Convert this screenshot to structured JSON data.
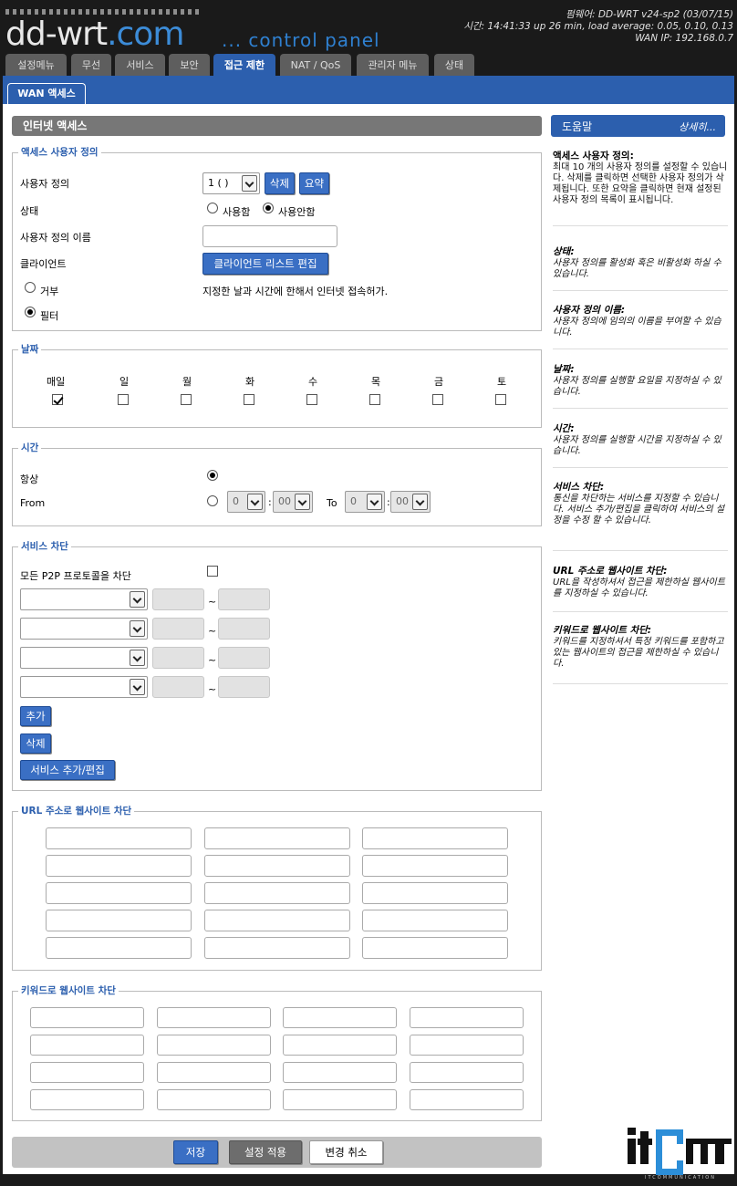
{
  "header": {
    "logo_text_main": "dd-wrt",
    "logo_text_suffix": ".com",
    "control_panel": "... control panel",
    "firmware": "펌웨어: DD-WRT v24-sp2 (03/07/15)",
    "uptime": "시간: 14:41:33 up 26 min, load average: 0.05, 0.10, 0.13",
    "wan_ip": "WAN IP: 192.168.0.7"
  },
  "tabs": [
    "설정메뉴",
    "무선",
    "서비스",
    "보안",
    "접근 제한",
    "NAT / QoS",
    "관리자 메뉴",
    "상태"
  ],
  "subtab": "WAN 액세스",
  "section_title": "인터넷 액세스",
  "policy": {
    "legend": "액세스 사용자 정의",
    "policy_label": "사용자 정의",
    "policy_value": "1 ( )",
    "delete_btn": "삭제",
    "summary_btn": "요약",
    "status_label": "상태",
    "enable_label": "사용함",
    "disable_label": "사용안함",
    "name_label": "사용자 정의 이름",
    "name_value": "",
    "client_label": "클라이언트",
    "client_btn": "클라이언트 리스트 편집",
    "deny_label": "거부",
    "filter_label": "필터",
    "info_text": "지정한 날과 시간에 한해서 인터넷 접속허가."
  },
  "days": {
    "legend": "날짜",
    "labels": [
      "매일",
      "일",
      "월",
      "화",
      "수",
      "목",
      "금",
      "토"
    ],
    "checked": [
      true,
      false,
      false,
      false,
      false,
      false,
      false,
      false
    ]
  },
  "time": {
    "legend": "시간",
    "always_label": "항상",
    "from_label": "From",
    "to_label": "To",
    "from_hour": "0",
    "from_min": "00",
    "to_hour": "0",
    "to_min": "00",
    "sep": ":"
  },
  "services": {
    "legend": "서비스 차단",
    "p2p_label": "모든 P2P 프로토콜을 차단",
    "tilde": "~",
    "add_btn": "추가",
    "delete_btn": "삭제",
    "edit_btn": "서비스 추가/편집"
  },
  "url_block": {
    "legend": "URL 주소로 웹사이트 차단"
  },
  "keyword_block": {
    "legend": "키워드로 웹사이트 차단"
  },
  "footer": {
    "save": "저장",
    "apply": "설정 적용",
    "cancel": "변경 취소"
  },
  "help": {
    "title": "도움말",
    "more": "상세히...",
    "items": [
      {
        "h": "액세스 사용자 정의:",
        "b": "최대 10 개의 사용자 정의를 설정할 수 있습니다. 삭제를 클릭하면 선택한 사용자 정의가 삭제됩니다. 또한 요약을 클릭하면 현재 설정된 사용자 정의 목록이 표시됩니다."
      },
      {
        "h": "상태:",
        "b": "사용자 정의를 활성화 혹은 비활성화 하실 수 있습니다."
      },
      {
        "h": "사용자 정의 이름:",
        "b": "사용자 정의에 임의의 이름을 부여할 수 있습니다."
      },
      {
        "h": "날짜:",
        "b": "사용자 정의를 실행할 요일을 지정하실 수 있습니다."
      },
      {
        "h": "시간:",
        "b": "사용자 정의를 실행할 시간을 지정하실 수 있습니다."
      },
      {
        "h": "서비스 차단:",
        "b": "통신을 차단하는 서비스를 지정할 수 있습니다. 서비스 추가/편집을 클릭하여 서비스의 설정을 수정 할 수 있습니다."
      },
      {
        "h": "URL 주소로 웹사이트 차단:",
        "b": "URL을 작성하셔서 접근을 제한하실 웹사이트를 지정하실 수 있습니다."
      },
      {
        "h": "키워드로 웹사이트 차단:",
        "b": "키워드를 지정하셔서 특정 키워드를 포함하고 있는 웹사이트의 접근을 제한하실 수 있습니다."
      }
    ]
  },
  "brand": {
    "text": "itcm",
    "sub": "ITCOMMUNICATION"
  },
  "colors": {
    "accent": "#2c5fae",
    "header_bg": "#1a1a1a",
    "tab_bg": "#5e5e5e"
  }
}
